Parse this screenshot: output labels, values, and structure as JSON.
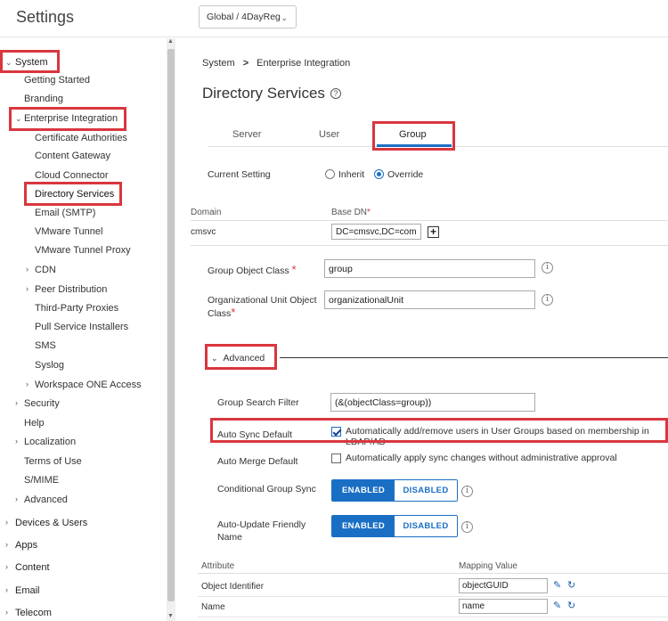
{
  "header": {
    "app_title": "Settings",
    "org_selector": "Global / 4DayReg"
  },
  "sidebar": {
    "items": [
      {
        "label": "System",
        "expanded": true
      },
      {
        "label": "Getting Started"
      },
      {
        "label": "Branding"
      },
      {
        "label": "Enterprise Integration",
        "expanded": true
      },
      {
        "label": "Certificate Authorities"
      },
      {
        "label": "Content Gateway"
      },
      {
        "label": "Cloud Connector"
      },
      {
        "label": "Directory Services",
        "selected": true
      },
      {
        "label": "Email (SMTP)"
      },
      {
        "label": "VMware Tunnel"
      },
      {
        "label": "VMware Tunnel Proxy"
      },
      {
        "label": "CDN"
      },
      {
        "label": "Peer Distribution"
      },
      {
        "label": "Third-Party Proxies"
      },
      {
        "label": "Pull Service Installers"
      },
      {
        "label": "SMS"
      },
      {
        "label": "Syslog"
      },
      {
        "label": "Workspace ONE Access"
      },
      {
        "label": "Security"
      },
      {
        "label": "Help"
      },
      {
        "label": "Localization"
      },
      {
        "label": "Terms of Use"
      },
      {
        "label": "S/MIME"
      },
      {
        "label": "Advanced"
      },
      {
        "label": "Devices & Users"
      },
      {
        "label": "Apps"
      },
      {
        "label": "Content"
      },
      {
        "label": "Email"
      },
      {
        "label": "Telecom"
      }
    ]
  },
  "breadcrumb": {
    "root": "System",
    "separator": ">",
    "current": "Enterprise Integration"
  },
  "page_title": "Directory Services",
  "tabs": [
    {
      "label": "Server"
    },
    {
      "label": "User"
    },
    {
      "label": "Group",
      "active": true
    }
  ],
  "current_setting": {
    "label": "Current Setting",
    "options": [
      "Inherit",
      "Override"
    ],
    "selected": "Override"
  },
  "dn_table": {
    "columns": [
      "Domain",
      "Base DN"
    ],
    "rows": [
      {
        "domain": "cmsvc",
        "base_dn": "DC=cmsvc,DC=com"
      }
    ]
  },
  "group_object_class": {
    "label": "Group Object Class",
    "value": "group"
  },
  "org_unit_object_class": {
    "label": "Organizational Unit Object Class",
    "value": "organizationalUnit"
  },
  "advanced": {
    "label": "Advanced",
    "group_search_filter": {
      "label": "Group Search Filter",
      "value": "(&(objectClass=group))"
    },
    "auto_sync_default": {
      "label": "Auto Sync Default",
      "checked": true,
      "text": "Automatically add/remove users in User Groups based on membership in LDAP/AD"
    },
    "auto_merge_default": {
      "label": "Auto Merge Default",
      "checked": false,
      "text": "Automatically apply sync changes without administrative approval"
    },
    "conditional_group_sync": {
      "label": "Conditional Group Sync",
      "enabled_label": "ENABLED",
      "disabled_label": "DISABLED",
      "value": "ENABLED"
    },
    "auto_update_friendly_name": {
      "label": "Auto-Update Friendly Name",
      "enabled_label": "ENABLED",
      "disabled_label": "DISABLED",
      "value": "ENABLED"
    }
  },
  "attributes": {
    "columns": [
      "Attribute",
      "Mapping Value"
    ],
    "rows": [
      {
        "attribute": "Object Identifier",
        "value": "objectGUID"
      },
      {
        "attribute": "Name",
        "value": "name"
      }
    ]
  },
  "colors": {
    "accent": "#1a6fc4",
    "highlight": "#d9363e"
  }
}
